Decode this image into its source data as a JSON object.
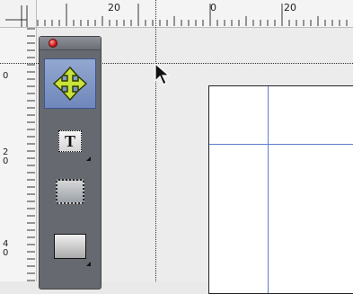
{
  "rulers": {
    "top_labels": [
      "20",
      "0",
      "20"
    ],
    "left_labels": [
      [
        "0"
      ],
      [
        "2",
        "0"
      ],
      [
        "4",
        "0"
      ]
    ]
  },
  "toolbox": {
    "tools": [
      {
        "name": "move-tool",
        "icon": "four-arrow-move-icon",
        "selected": true
      },
      {
        "name": "text-tool",
        "icon": "text-icon",
        "glyph": "T",
        "has_flyout": true
      },
      {
        "name": "frame-tool",
        "icon": "frame-icon"
      },
      {
        "name": "rectangle-tool",
        "icon": "rectangle-icon",
        "has_flyout": true
      }
    ]
  },
  "guides_color": "#5b7fcf",
  "selected_tool_color": "#7e95c6"
}
